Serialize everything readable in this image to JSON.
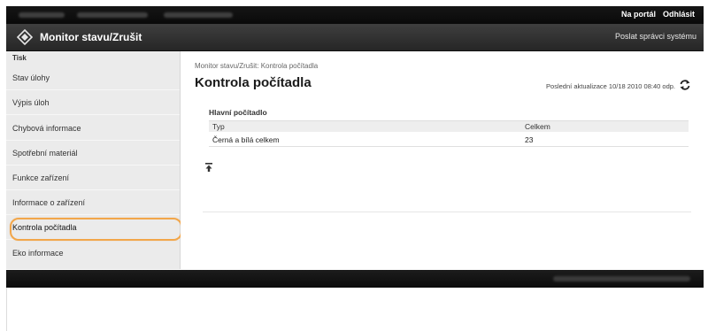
{
  "topbar": {
    "my_portal": "Na portál",
    "logout": "Odhlásit"
  },
  "titlebar": {
    "app_title": "Monitor stavu/Zrušit",
    "sys_admin_link": "Poslat správci systému"
  },
  "sidebar": {
    "section": "Tisk",
    "items": [
      {
        "label": "Stav úlohy"
      },
      {
        "label": "Výpis úloh"
      },
      {
        "label": "Chybová informace"
      },
      {
        "label": "Spotřební materiál"
      },
      {
        "label": "Funkce zařízení"
      },
      {
        "label": "Informace o zařízení"
      },
      {
        "label": "Kontrola počítadla"
      },
      {
        "label": "Eko informace"
      }
    ],
    "active_item": "Kontrola počítadla"
  },
  "main": {
    "breadcrumb": "Monitor stavu/Zrušit: Kontrola počítadla",
    "page_title": "Kontrola počítadla",
    "last_update": "Poslední aktualizace 10/18 2010 08:40 odp.",
    "panel_title": "Hlavní počítadlo",
    "table": {
      "headers": [
        "Typ",
        "Celkem"
      ],
      "rows": [
        [
          "Černá a bílá celkem",
          "23"
        ]
      ]
    }
  },
  "icons": {
    "logo": "diamond-logo-icon",
    "refresh": "refresh-icon",
    "back_to_top": "top-arrow-icon"
  },
  "colors": {
    "highlight_ring": "#f2a64a",
    "title_bar": "#2f2f2f",
    "sidebar_bg": "#ebebeb"
  }
}
